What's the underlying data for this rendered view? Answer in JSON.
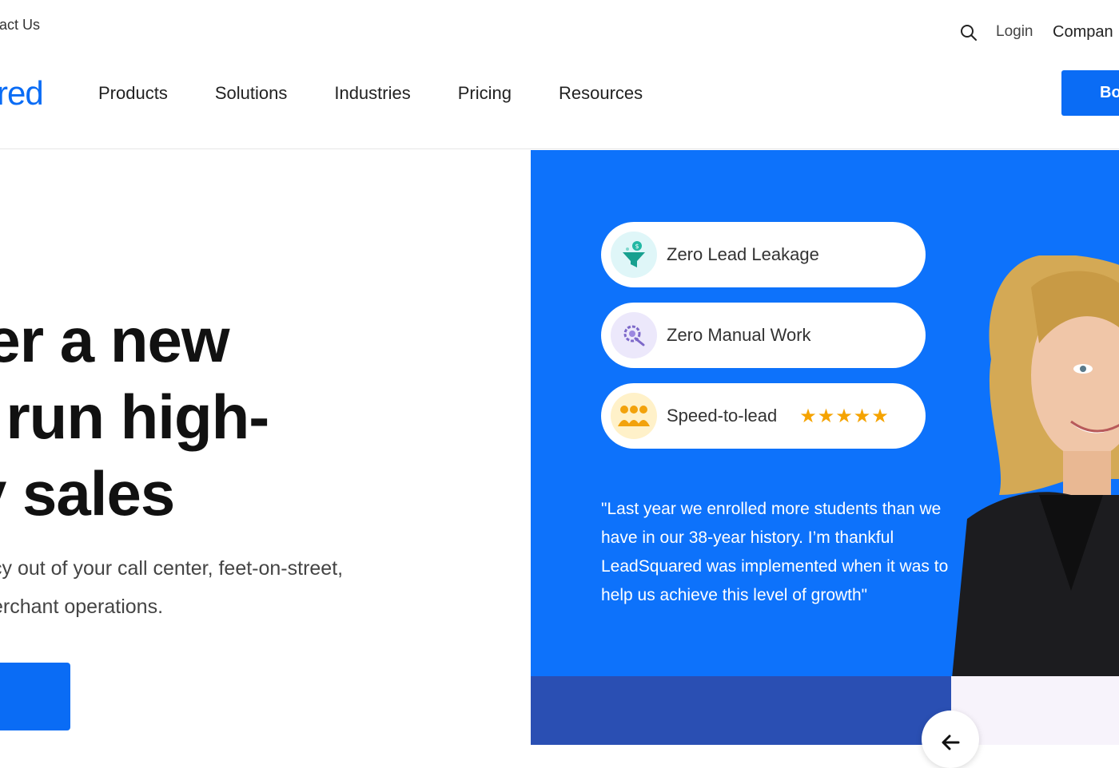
{
  "topbar": {
    "contact": "tact Us",
    "login": "Login",
    "company": "Compan"
  },
  "logo": {
    "text": "red"
  },
  "nav": {
    "items": [
      "Products",
      "Solutions",
      "Industries",
      "Pricing",
      "Resources"
    ],
    "cta": "Bo"
  },
  "hero": {
    "headline": [
      "ver a new",
      "o run high-",
      "ty sales"
    ],
    "subtext": [
      "cy out of your call center, feet-on-street,",
      "erchant operations."
    ]
  },
  "features": [
    {
      "label": "Zero Lead Leakage",
      "icon": "funnel-icon"
    },
    {
      "label": "Zero Manual Work",
      "icon": "gear-icon"
    },
    {
      "label": "Speed-to-lead",
      "icon": "team-icon",
      "stars": "★★★★★",
      "rating": 5
    }
  ],
  "quote": "\"Last year we enrolled more students than we have in our 38-year history. I’m thankful LeadSquared was implemented when it was to help us achieve this level of growth\"",
  "colors": {
    "accent": "#0a6cf5",
    "panel": "#0d72fb",
    "star": "#f5a300",
    "dark_band": "#2a4fb3"
  }
}
